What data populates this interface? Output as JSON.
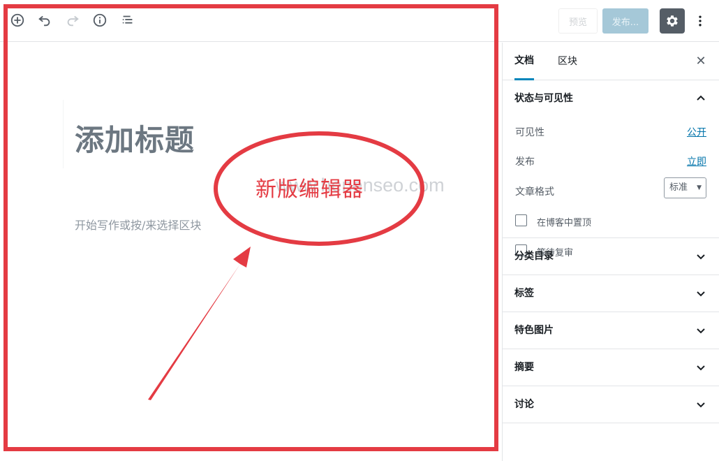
{
  "toolbar": {
    "icons": [
      "add-block-icon",
      "undo-icon",
      "redo-icon",
      "info-icon",
      "outline-icon"
    ],
    "preview_label": "预览",
    "publish_label": "发布...",
    "settings_icon": "gear-icon",
    "more_icon": "more-vertical-icon"
  },
  "editor": {
    "title_placeholder": "添加标题",
    "block_placeholder": "开始写作或按/来选择区块"
  },
  "watermark": "www.henenseo.com",
  "annotation": {
    "label": "新版编辑器",
    "color": "#e43b43"
  },
  "sidebar": {
    "tabs": [
      {
        "label": "文档",
        "active": true
      },
      {
        "label": "区块",
        "active": false
      }
    ],
    "status_panel": {
      "title": "状态与可见性",
      "visibility_label": "可见性",
      "visibility_value": "公开",
      "publish_label": "发布",
      "publish_value": "立即",
      "format_label": "文章格式",
      "format_value": "标准",
      "sticky_label": "在博客中置顶",
      "pending_label": "等待复审"
    },
    "panels": [
      {
        "title": "分类目录"
      },
      {
        "title": "标签"
      },
      {
        "title": "特色图片"
      },
      {
        "title": "摘要"
      },
      {
        "title": "讨论"
      }
    ]
  },
  "colors": {
    "accent": "#0085ba",
    "link": "#0073aa",
    "publish_disabled": "#a5c8d8",
    "settings_bg": "#555d66"
  }
}
